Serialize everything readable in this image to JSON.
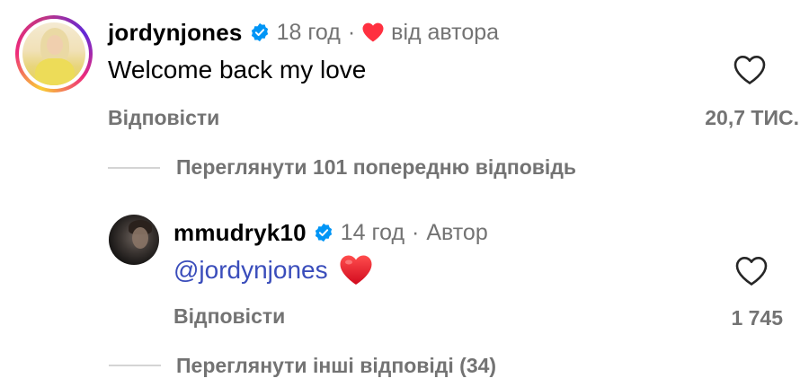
{
  "top_comment": {
    "username": "jordynjones",
    "time": "18 год",
    "separator": "·",
    "liked_by_author": "від автора",
    "text": "Welcome back my love",
    "reply_label": "Відповісти",
    "like_count": "20,7 ТИС."
  },
  "view_previous": {
    "label": "Переглянути 101 попередню відповідь"
  },
  "reply_comment": {
    "username": "mmudryk10",
    "time": "14 год",
    "separator": "·",
    "author_label": "Автор",
    "mention": "@jordynjones",
    "emoji": "❤️",
    "reply_label": "Відповісти",
    "like_count": "1 745"
  },
  "view_other": {
    "label": "Переглянути інші відповіді (34)"
  },
  "colors": {
    "verified": "#0095f6",
    "heart_red": "#ff3040",
    "mention": "#3a4dbb",
    "muted": "#737373"
  },
  "icons": {
    "verified": "verified-badge-icon",
    "red_heart": "heart-filled-icon",
    "like": "heart-outline-icon"
  }
}
